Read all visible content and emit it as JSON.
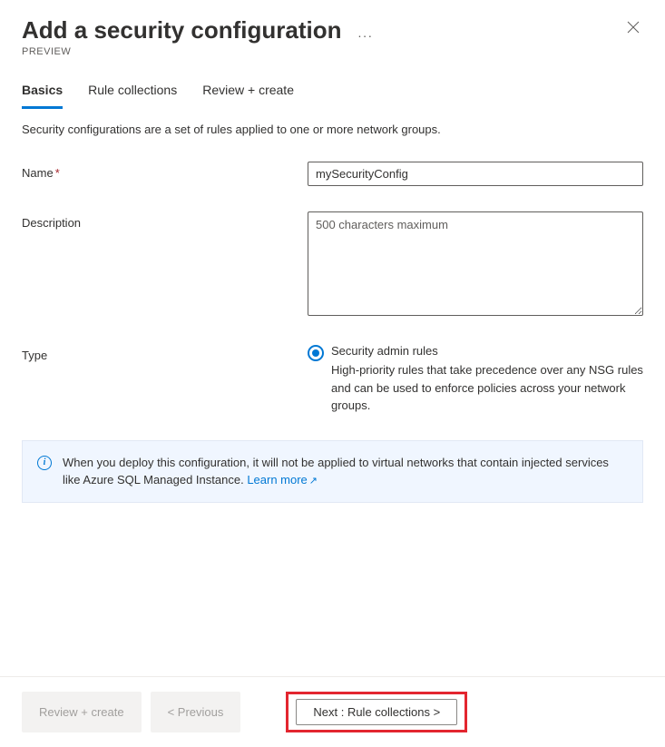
{
  "header": {
    "title": "Add a security configuration",
    "preview": "PREVIEW"
  },
  "tabs": [
    {
      "label": "Basics",
      "active": true
    },
    {
      "label": "Rule collections",
      "active": false
    },
    {
      "label": "Review + create",
      "active": false
    }
  ],
  "intro": "Security configurations are a set of rules applied to one or more network groups.",
  "form": {
    "name": {
      "label": "Name",
      "required": true,
      "value": "mySecurityConfig"
    },
    "description": {
      "label": "Description",
      "placeholder": "500 characters maximum",
      "value": ""
    },
    "type": {
      "label": "Type",
      "option_label": "Security admin rules",
      "option_desc": "High-priority rules that take precedence over any NSG rules and can be used to enforce policies across your network groups."
    }
  },
  "info": {
    "text": "When you deploy this configuration, it will not be applied to virtual networks that contain injected services like Azure SQL Managed Instance. ",
    "link_text": "Learn more"
  },
  "footer": {
    "review": "Review + create",
    "previous": "< Previous",
    "next": "Next : Rule collections >"
  }
}
